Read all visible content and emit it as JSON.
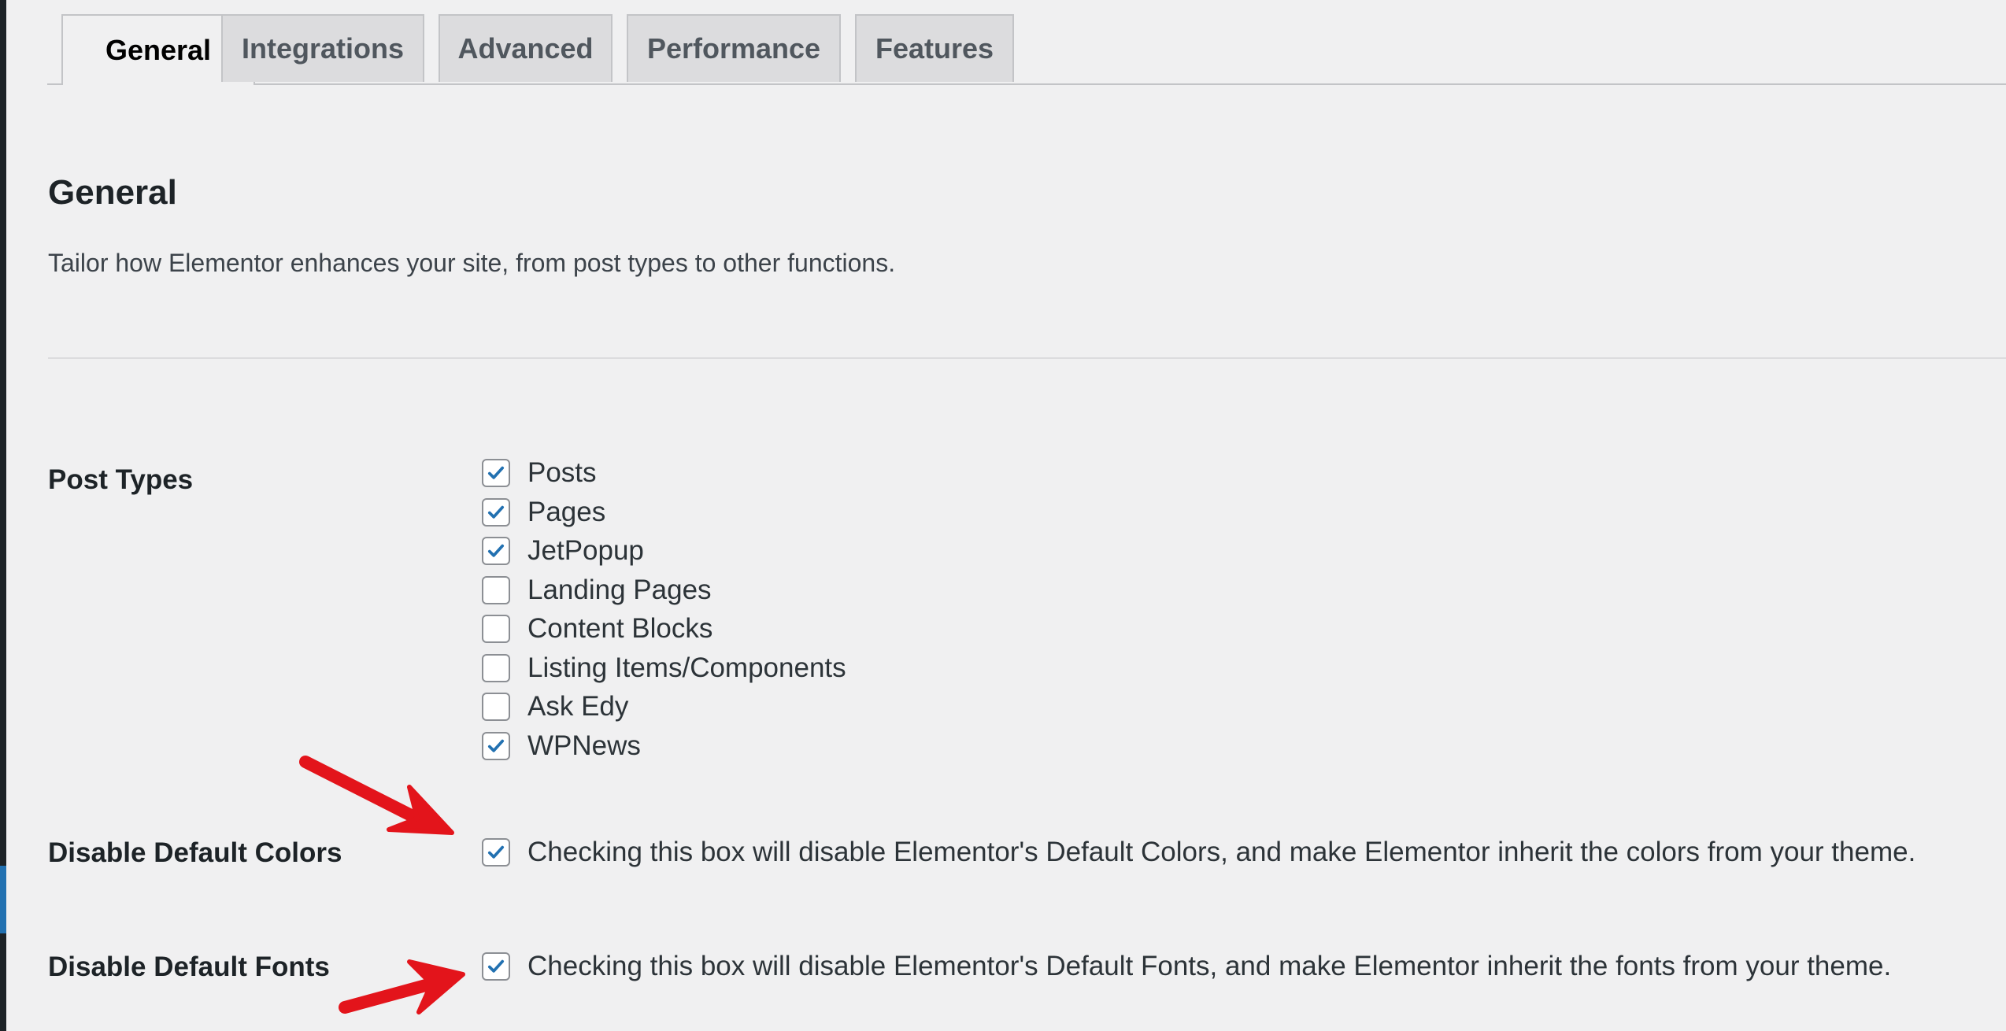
{
  "tabs": [
    {
      "label": "General",
      "active": true
    },
    {
      "label": "Integrations",
      "active": false
    },
    {
      "label": "Advanced",
      "active": false
    },
    {
      "label": "Performance",
      "active": false
    },
    {
      "label": "Features",
      "active": false
    }
  ],
  "section": {
    "title": "General",
    "description": "Tailor how Elementor enhances your site, from post types to other functions."
  },
  "post_types": {
    "label": "Post Types",
    "items": [
      {
        "label": "Posts",
        "checked": true
      },
      {
        "label": "Pages",
        "checked": true
      },
      {
        "label": "JetPopup",
        "checked": true
      },
      {
        "label": "Landing Pages",
        "checked": false
      },
      {
        "label": "Content Blocks",
        "checked": false
      },
      {
        "label": "Listing Items/Components",
        "checked": false
      },
      {
        "label": "Ask Edy",
        "checked": false
      },
      {
        "label": "WPNews",
        "checked": true
      }
    ]
  },
  "disable_colors": {
    "label": "Disable Default Colors",
    "checked": true,
    "description": "Checking this box will disable Elementor's Default Colors, and make Elementor inherit the colors from your theme."
  },
  "disable_fonts": {
    "label": "Disable Default Fonts",
    "checked": true,
    "description": "Checking this box will disable Elementor's Default Fonts, and make Elementor inherit the fonts from your theme."
  },
  "colors": {
    "checkmark": "#2271b1",
    "annotation_arrow": "#e3141b"
  }
}
